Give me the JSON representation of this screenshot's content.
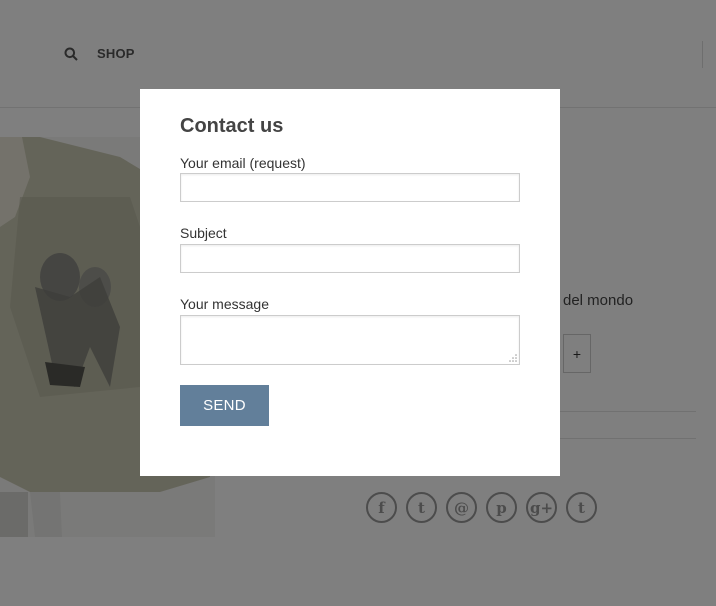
{
  "header": {
    "search_icon": "search-icon",
    "nav_shop": "SHOP"
  },
  "product": {
    "subtitle_fragment": "del mondo",
    "qty_plus": "+",
    "share_icons": [
      "facebook-icon",
      "twitter-icon",
      "email-icon",
      "pinterest-icon",
      "google-plus-icon",
      "tumblr-icon"
    ],
    "share_glyphs": [
      "f",
      "t",
      "@",
      "p",
      "g+",
      "t"
    ]
  },
  "modal": {
    "title": "Contact us",
    "fields": [
      {
        "label": "Your email (request)",
        "value": ""
      },
      {
        "label": "Subject",
        "value": ""
      },
      {
        "label": "Your message",
        "value": ""
      }
    ],
    "send_label": "SEND"
  },
  "colors": {
    "overlay": "rgba(0,0,0,0.5)",
    "send_button": "#627f9a",
    "modal_bg": "#ffffff"
  }
}
